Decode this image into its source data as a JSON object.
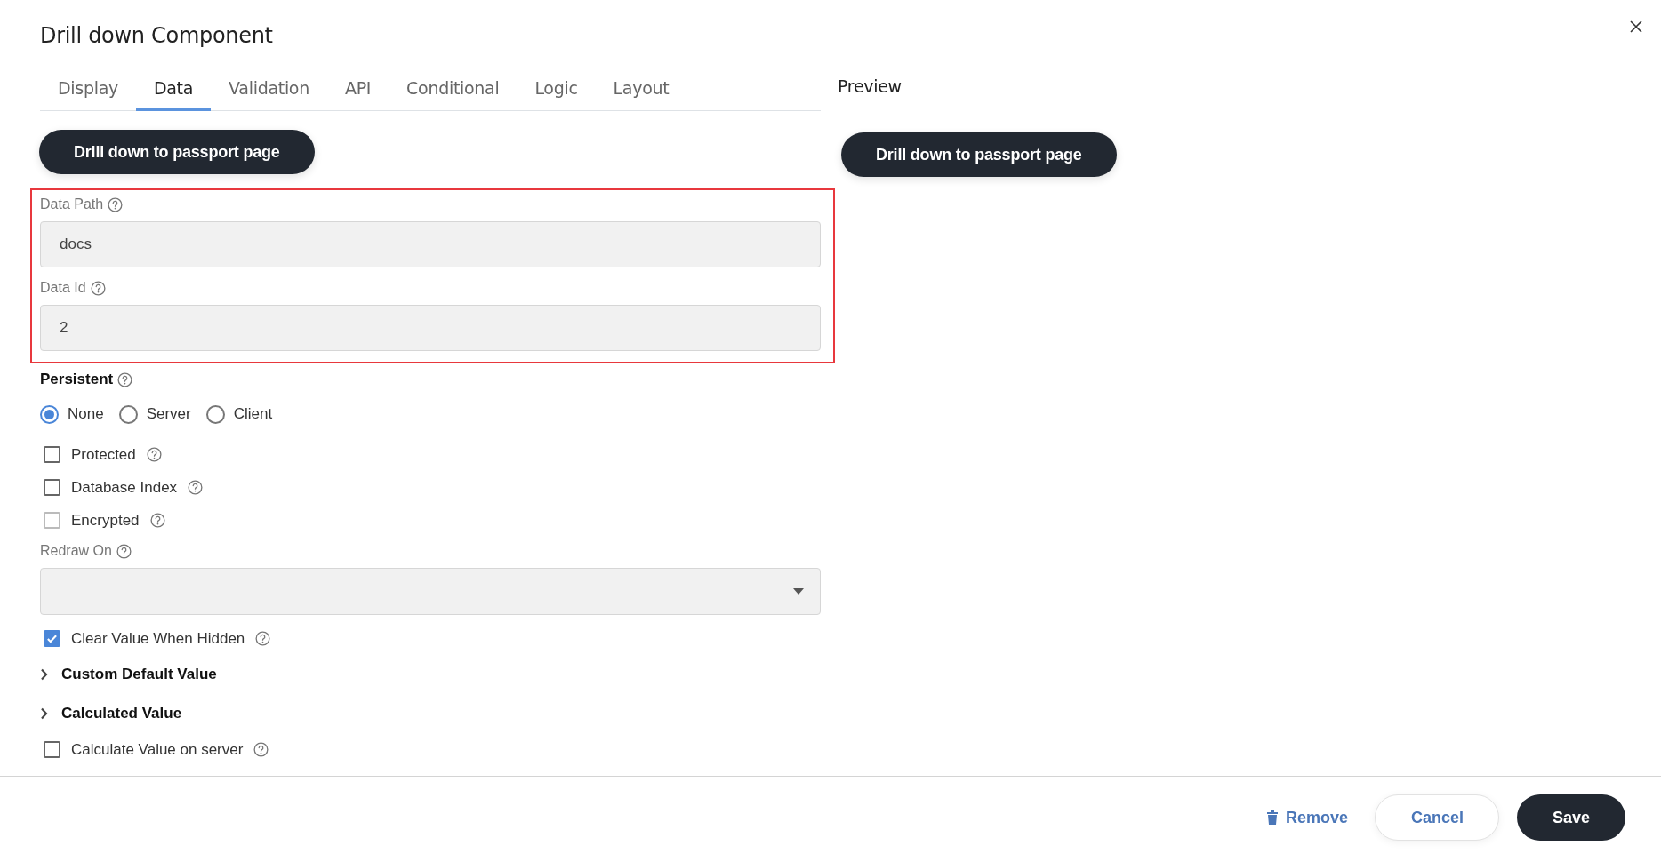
{
  "dialog": {
    "title": "Drill down Component"
  },
  "tabs": [
    {
      "label": "Display",
      "selected": false
    },
    {
      "label": "Data",
      "selected": true
    },
    {
      "label": "Validation",
      "selected": false
    },
    {
      "label": "API",
      "selected": false
    },
    {
      "label": "Conditional",
      "selected": false
    },
    {
      "label": "Logic",
      "selected": false
    },
    {
      "label": "Layout",
      "selected": false
    }
  ],
  "component_button": {
    "label": "Drill down to passport page"
  },
  "highlighted_fields": [
    {
      "label": "Data Path",
      "value": "docs"
    },
    {
      "label": "Data Id",
      "value": "2"
    }
  ],
  "persistent": {
    "label": "Persistent",
    "options": [
      {
        "label": "None",
        "selected": true
      },
      {
        "label": "Server",
        "selected": false
      },
      {
        "label": "Client",
        "selected": false
      }
    ]
  },
  "fields": [
    {
      "kind": "checkbox",
      "label": "Protected",
      "checked": false,
      "disabled": false
    },
    {
      "kind": "checkbox",
      "label": "Database Index",
      "checked": false,
      "disabled": false
    },
    {
      "kind": "checkbox",
      "label": "Encrypted",
      "checked": false,
      "disabled": true
    },
    {
      "kind": "select",
      "label": "Redraw On"
    },
    {
      "kind": "checkbox",
      "label": "Clear Value When Hidden",
      "checked": true,
      "disabled": false
    },
    {
      "kind": "section",
      "label": "Custom Default Value",
      "expanded": false
    },
    {
      "kind": "section",
      "label": "Calculated Value",
      "expanded": false
    },
    {
      "kind": "checkbox",
      "label": "Calculate Value on server",
      "checked": false,
      "disabled": false
    }
  ],
  "preview": {
    "title": "Preview",
    "button": "Drill down to passport page"
  },
  "footer": {
    "buttons": [
      {
        "kind": "link",
        "label": "Remove"
      },
      {
        "kind": "secondary",
        "label": "Cancel"
      },
      {
        "kind": "primary",
        "label": "Save"
      }
    ]
  }
}
